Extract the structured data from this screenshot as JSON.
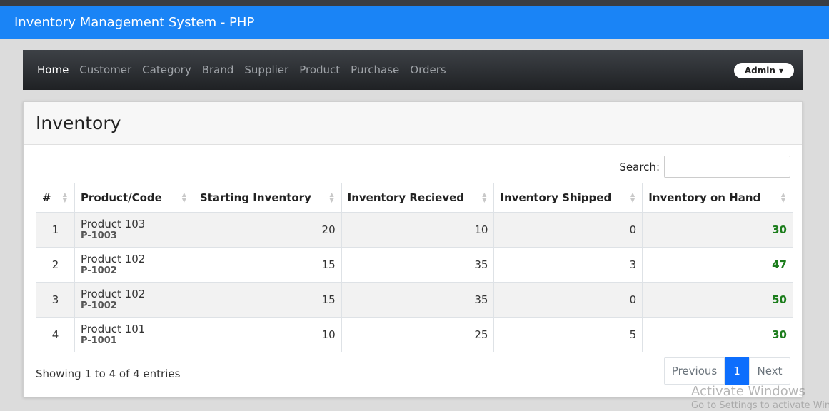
{
  "app": {
    "title": "Inventory Management System - PHP"
  },
  "nav": {
    "items": [
      {
        "label": "Home"
      },
      {
        "label": "Customer"
      },
      {
        "label": "Category"
      },
      {
        "label": "Brand"
      },
      {
        "label": "Supplier"
      },
      {
        "label": "Product"
      },
      {
        "label": "Purchase"
      },
      {
        "label": "Orders"
      }
    ],
    "active": "Home",
    "user_label": "Admin"
  },
  "page": {
    "title": "Inventory"
  },
  "search": {
    "label": "Search:",
    "value": ""
  },
  "table": {
    "columns": [
      "#",
      "Product/Code",
      "Starting Inventory",
      "Inventory Recieved",
      "Inventory Shipped",
      "Inventory on Hand"
    ],
    "rows": [
      {
        "index": "1",
        "product": "Product 103",
        "code": "P-1003",
        "starting": "20",
        "received": "10",
        "shipped": "0",
        "on_hand": "30"
      },
      {
        "index": "2",
        "product": "Product 102",
        "code": "P-1002",
        "starting": "15",
        "received": "35",
        "shipped": "3",
        "on_hand": "47"
      },
      {
        "index": "3",
        "product": "Product 102",
        "code": "P-1002",
        "starting": "15",
        "received": "35",
        "shipped": "0",
        "on_hand": "50"
      },
      {
        "index": "4",
        "product": "Product 101",
        "code": "P-1001",
        "starting": "10",
        "received": "25",
        "shipped": "5",
        "on_hand": "30"
      }
    ]
  },
  "footer": {
    "info": "Showing 1 to 4 of 4 entries",
    "prev_label": "Previous",
    "current_page": "1",
    "next_label": "Next"
  },
  "watermark": {
    "line1": "Activate Windows",
    "line2": "Go to Settings to activate Windows."
  },
  "colors": {
    "appbar": "#1a84f6",
    "on_hand": "#1c7d1c",
    "pager_active": "#0d6efd"
  }
}
